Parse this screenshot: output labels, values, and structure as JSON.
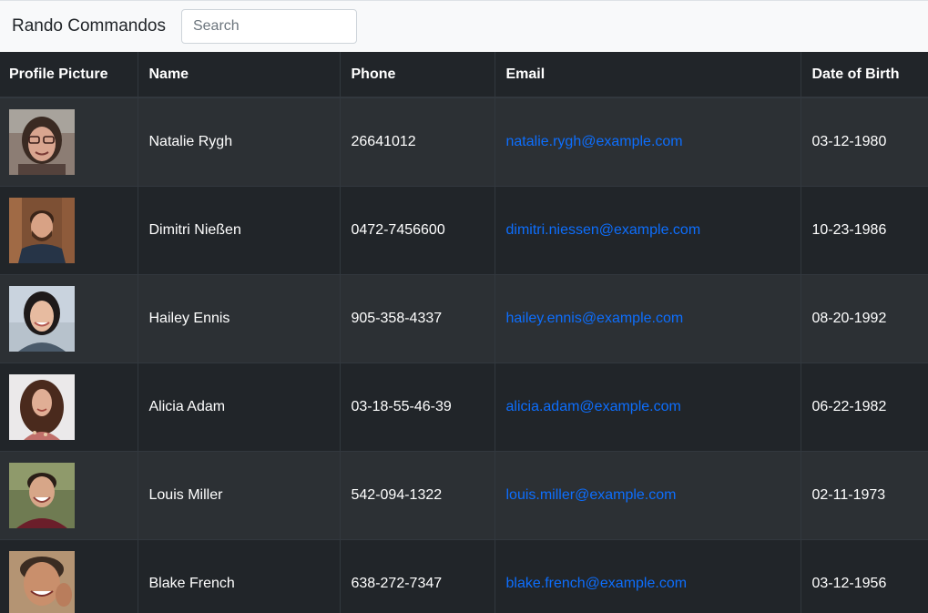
{
  "navbar": {
    "brand": "Rando Commandos",
    "search_placeholder": "Search"
  },
  "table": {
    "headers": [
      "Profile Picture",
      "Name",
      "Phone",
      "Email",
      "Date of Birth"
    ],
    "rows": [
      {
        "name": "Natalie Rygh",
        "phone": "26641012",
        "email": "natalie.rygh@example.com",
        "dob": "03-12-1980"
      },
      {
        "name": "Dimitri Nießen",
        "phone": "0472-7456600",
        "email": "dimitri.niessen@example.com",
        "dob": "10-23-1986"
      },
      {
        "name": "Hailey Ennis",
        "phone": "905-358-4337",
        "email": "hailey.ennis@example.com",
        "dob": "08-20-1992"
      },
      {
        "name": "Alicia Adam",
        "phone": "03-18-55-46-39",
        "email": "alicia.adam@example.com",
        "dob": "06-22-1982"
      },
      {
        "name": "Louis Miller",
        "phone": "542-094-1322",
        "email": "louis.miller@example.com",
        "dob": "02-11-1973"
      },
      {
        "name": "Blake French",
        "phone": "638-272-7347",
        "email": "blake.french@example.com",
        "dob": "03-12-1956"
      }
    ]
  },
  "colors": {
    "table_bg": "#212529",
    "stripe_bg": "#2c3034",
    "link": "#0d6efd",
    "navbar_bg": "#f8f9fa"
  }
}
